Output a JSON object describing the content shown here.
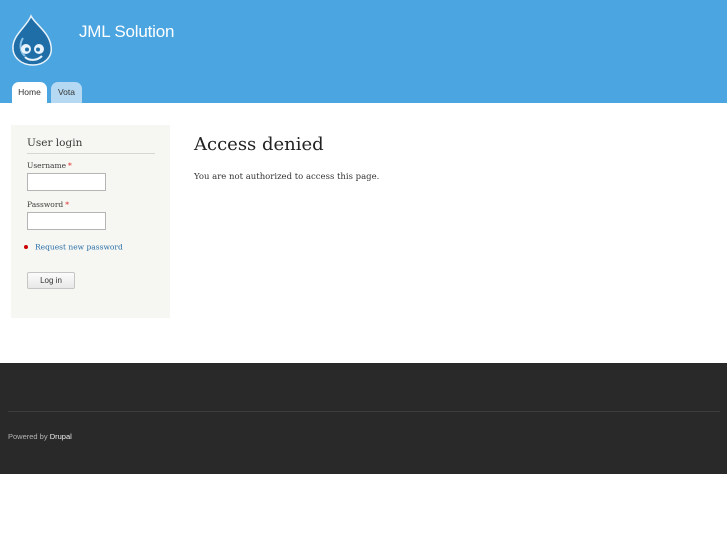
{
  "header": {
    "site_name": "JML Solution",
    "logo_icon": "drupal-drop-icon",
    "background_color": "#4aa5e1"
  },
  "tabs": [
    {
      "label": "Home",
      "active": true
    },
    {
      "label": "Vota",
      "active": false
    }
  ],
  "sidebar": {
    "block_title": "User login",
    "username_label": "Username",
    "password_label": "Password",
    "required_marker": "*",
    "username_value": "",
    "password_value": "",
    "request_password_link": "Request new password",
    "login_button": "Log in"
  },
  "main": {
    "title": "Access denied",
    "message": "You are not authorized to access this page."
  },
  "footer": {
    "powered_prefix": "Powered by",
    "powered_link": "Drupal",
    "background_color": "#292929"
  }
}
